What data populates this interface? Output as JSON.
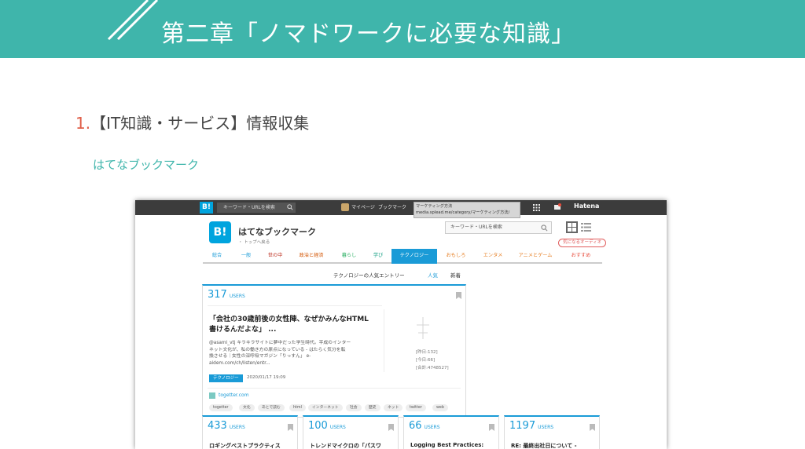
{
  "slide": {
    "title": "第二章「ノマドワークに必要な知識」",
    "section_number": "1.",
    "section_title": "【IT知識・サービス】情報収集",
    "subtitle": "はてなブックマーク",
    "accent_color": "#3fb5ab",
    "number_color": "#e0604a"
  },
  "browser": {
    "topbar": {
      "logo": "B!",
      "search_placeholder": "キーワード・URLを検索",
      "mypage": "マイページ",
      "bookmark": "ブックマーク",
      "tooltip_line1": "マーケティング方法",
      "tooltip_line2": "media.splead.me/category/マーケティング方法/",
      "hatena": "Hatena"
    },
    "header": {
      "logo": "B!",
      "brand": "はてなブックマーク",
      "back_to_top": "・ トップへ戻る",
      "search_placeholder": "キーワード・URLを検索",
      "audio_link": "気になるオーディオ"
    },
    "nav": {
      "tabs": [
        {
          "label": "総合",
          "color": "#1a9bd7"
        },
        {
          "label": "一般",
          "color": "#1a9bd7"
        },
        {
          "label": "世の中",
          "color": "#c0392b"
        },
        {
          "label": "政治と経済",
          "color": "#d35400"
        },
        {
          "label": "暮らし",
          "color": "#27ae60"
        },
        {
          "label": "学び",
          "color": "#16a085"
        },
        {
          "label": "テクノロジー",
          "color": "#ffffff"
        },
        {
          "label": "おもしろ",
          "color": "#e67e22"
        },
        {
          "label": "エンタメ",
          "color": "#e67e22"
        },
        {
          "label": "アニメとゲーム",
          "color": "#e67e22"
        },
        {
          "label": "おすすめ",
          "color": "#e74c3c"
        }
      ],
      "active_index": 6
    },
    "section": {
      "label": "テクノロジーの人気エントリー",
      "tab_popular": "人気",
      "tab_new": "新着",
      "popular_color": "#1a9bd7"
    },
    "main_entry": {
      "users": "317",
      "users_label": "USERS",
      "title_line1": "「会社の30歳前後の女性陣、なぜかみんなHTML",
      "title_line2": "書けるんだよな」 ...",
      "desc_line1": "@asami_vtj キラキラサイトに夢中だった学生時代。平成のインター",
      "desc_line2": "ネット文化が、私の働き方の原点になっている - はたらく気分を転",
      "desc_line3": "換させる｜女性の深呼吸マガジン「りっすん」 e-",
      "desc_line4": "aidem.com/ch/listen/entr...",
      "thumb_line1": "[昨日:132]",
      "thumb_line2": "[今日:66]",
      "thumb_line3": "[合計:4748527]",
      "category": "テクノロジー",
      "date": "2020/01/17 19:09",
      "domain": "togetter.com",
      "tags": [
        "togetter",
        "文化",
        "あとで読む",
        "html",
        "インターネット",
        "社会",
        "歴史",
        "ネット",
        "twitter",
        "web"
      ]
    },
    "mini_entries": [
      {
        "users": "433",
        "users_label": "USERS",
        "title": "ロギングベストプラクティス"
      },
      {
        "users": "100",
        "users_label": "USERS",
        "title": "トレンドマイクロの「パスワ"
      },
      {
        "users": "66",
        "users_label": "USERS",
        "title": "Logging Best Practices:"
      },
      {
        "users": "1197",
        "users_label": "USERS",
        "title": "RE: 最終出社日について -"
      }
    ]
  }
}
